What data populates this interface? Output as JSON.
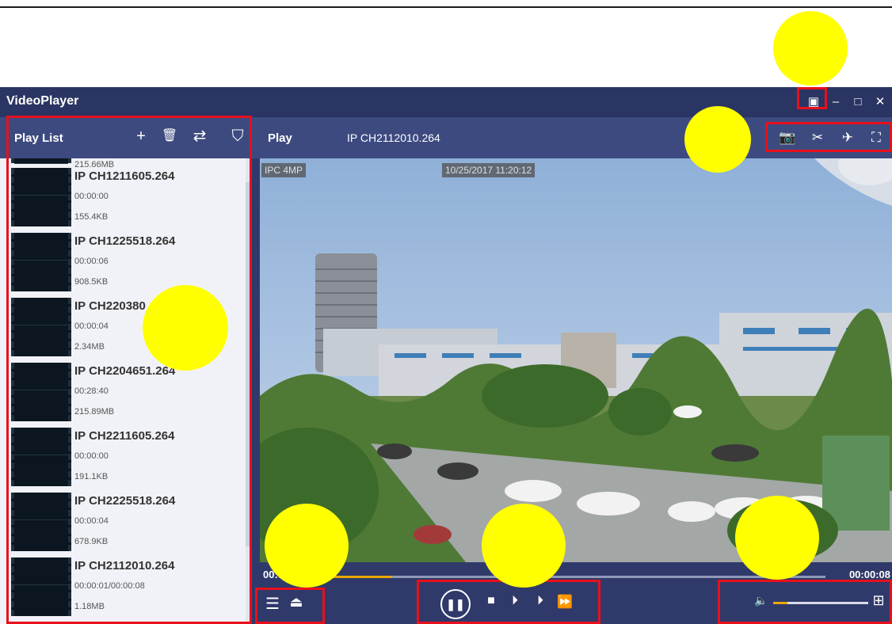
{
  "window": {
    "title": "VideoPlayer",
    "buttons": {
      "menu": "▣",
      "minimize": "–",
      "maximize": "□",
      "close": "✕"
    }
  },
  "playlist": {
    "header": "Play List",
    "tools": {
      "add": "+",
      "delete": "🗑",
      "loop": "⇄",
      "filter": "⛉"
    },
    "partial_top_size": "215.66MB",
    "items": [
      {
        "name": "IP CH1211605.264",
        "duration": "00:00:00",
        "size": "155.4KB"
      },
      {
        "name": "IP CH1225518.264",
        "duration": "00:00:06",
        "size": "908.5KB"
      },
      {
        "name": "IP CH220380",
        "duration": "00:00:04",
        "size": "2.34MB"
      },
      {
        "name": "IP CH2204651.264",
        "duration": "00:28:40",
        "size": "215.89MB"
      },
      {
        "name": "IP CH2211605.264",
        "duration": "00:00:00",
        "size": "191.1KB"
      },
      {
        "name": "IP CH2225518.264",
        "duration": "00:00:04",
        "size": "678.9KB"
      },
      {
        "name": "IP CH2112010.264",
        "duration": "00:00:01/00:00:08",
        "size": "1.18MB"
      }
    ]
  },
  "player": {
    "header": "Play",
    "current_file": "IP CH2112010.264",
    "tools": {
      "snapshot": "📷",
      "clip": "✂",
      "pin": "✈",
      "fullscreen": "⛶"
    },
    "osd": {
      "camera": "IPC 4MP",
      "timestamp": "10/25/2017 11:20:12"
    },
    "time_elapsed": "00:00:01",
    "time_total": "00:00:08",
    "progress": 0.2,
    "volume": 0.15,
    "controls": {
      "list": "☰",
      "eject": "⏏",
      "pause": "❚❚",
      "stop": "■",
      "step_back": "⏵",
      "step_forward": "⏵",
      "fast_forward": "⏩",
      "volume": "🔈",
      "grid": "⊞"
    }
  },
  "colors": {
    "accent": "#e8a700",
    "highlight": "#e8101b",
    "marker": "#ffff00",
    "chrome": "#2f3a6a"
  }
}
